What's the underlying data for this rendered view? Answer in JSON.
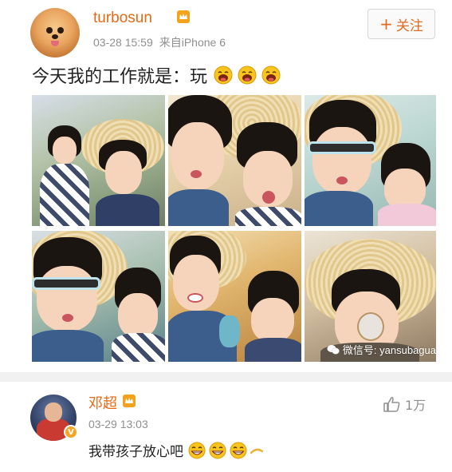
{
  "post": {
    "username": "turbosun",
    "time": "03-28 15:59",
    "source": "来自iPhone 6",
    "follow_label": "关注",
    "text": "今天我的工作就是：玩",
    "watermark": "微信号: yansubagua"
  },
  "comment": {
    "username": "邓超",
    "time": "03-29 13:03",
    "text": "我带孩子放心吧",
    "like_count": "1万"
  },
  "colors": {
    "username": "#e46a14",
    "meta": "#8f8f8f",
    "follow": "#e06a1e",
    "divider": "#f1f1f1"
  }
}
